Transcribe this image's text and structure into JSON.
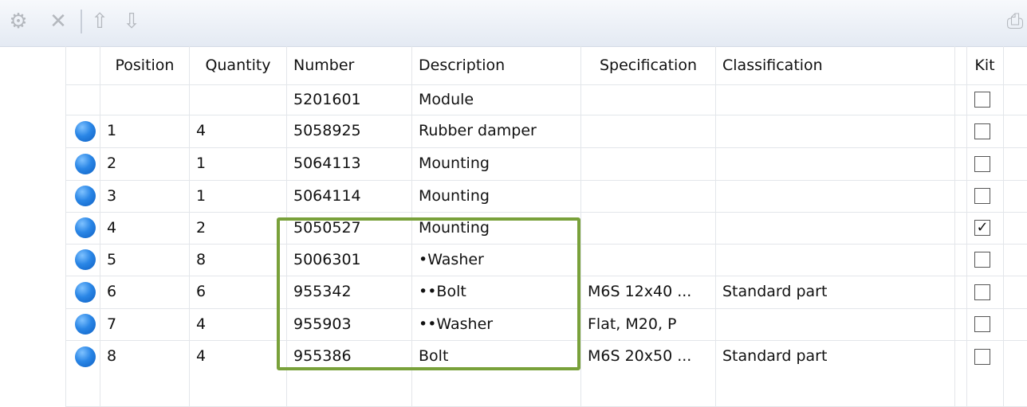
{
  "toolbar": {
    "icons": [
      "gear-icon",
      "close-icon",
      "move-up-icon",
      "move-down-icon",
      "print-icon"
    ],
    "glyphs": {
      "gear": "⚙",
      "close": "✕",
      "up": "⇧",
      "down": "⇩",
      "print": "⎙"
    }
  },
  "table": {
    "columns": [
      "Position",
      "Quantity",
      "Number",
      "Description",
      "Specification",
      "Classification",
      "Kit"
    ],
    "rows": [
      {
        "position": "",
        "quantity": "",
        "number": "5201601",
        "description": "Module",
        "specification": "",
        "classification": "",
        "kit": false,
        "marker": false
      },
      {
        "position": "1",
        "quantity": "4",
        "number": "5058925",
        "description": "Rubber damper",
        "specification": "",
        "classification": "",
        "kit": false,
        "marker": true
      },
      {
        "position": "2",
        "quantity": "1",
        "number": "5064113",
        "description": "Mounting",
        "specification": "",
        "classification": "",
        "kit": false,
        "marker": true
      },
      {
        "position": "3",
        "quantity": "1",
        "number": "5064114",
        "description": "Mounting",
        "specification": "",
        "classification": "",
        "kit": false,
        "marker": true
      },
      {
        "position": "4",
        "quantity": "2",
        "number": "5050527",
        "description": "Mounting",
        "specification": "",
        "classification": "",
        "kit": true,
        "marker": true
      },
      {
        "position": "5",
        "quantity": "8",
        "number": "5006301",
        "description": "•Washer",
        "specification": "",
        "classification": "",
        "kit": false,
        "marker": true
      },
      {
        "position": "6",
        "quantity": "6",
        "number": "955342",
        "description": "••Bolt",
        "specification": "M6S  12x40 ...",
        "classification": "Standard part",
        "kit": false,
        "marker": true
      },
      {
        "position": "7",
        "quantity": "4",
        "number": "955903",
        "description": "••Washer",
        "specification": "Flat, M20, P",
        "classification": "",
        "kit": false,
        "marker": true
      },
      {
        "position": "8",
        "quantity": "4",
        "number": "955386",
        "description": "Bolt",
        "specification": "M6S  20x50 ...",
        "classification": "Standard part",
        "kit": false,
        "marker": true
      }
    ]
  },
  "colors": {
    "highlight": "#79a13a",
    "marker": "#2a86e6"
  }
}
